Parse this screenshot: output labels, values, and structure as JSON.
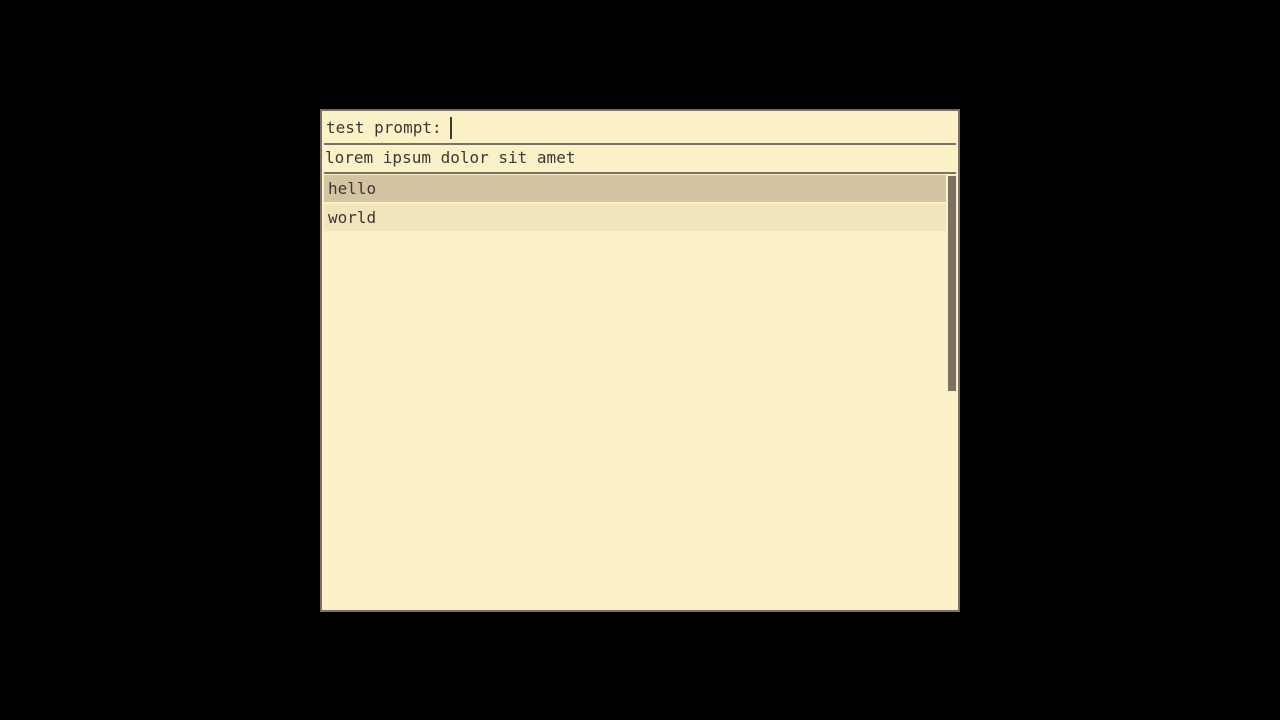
{
  "prompt": {
    "label": "test prompt:",
    "value": ""
  },
  "message": "lorem ipsum dolor sit amet",
  "items": [
    {
      "label": "hello",
      "selected": true
    },
    {
      "label": "world",
      "selected": false
    }
  ],
  "colors": {
    "background": "#fbf1c7",
    "border": "#7c6f64",
    "text": "#3c3836",
    "selected": "#d5c4a1",
    "item": "#f2e5bc"
  }
}
